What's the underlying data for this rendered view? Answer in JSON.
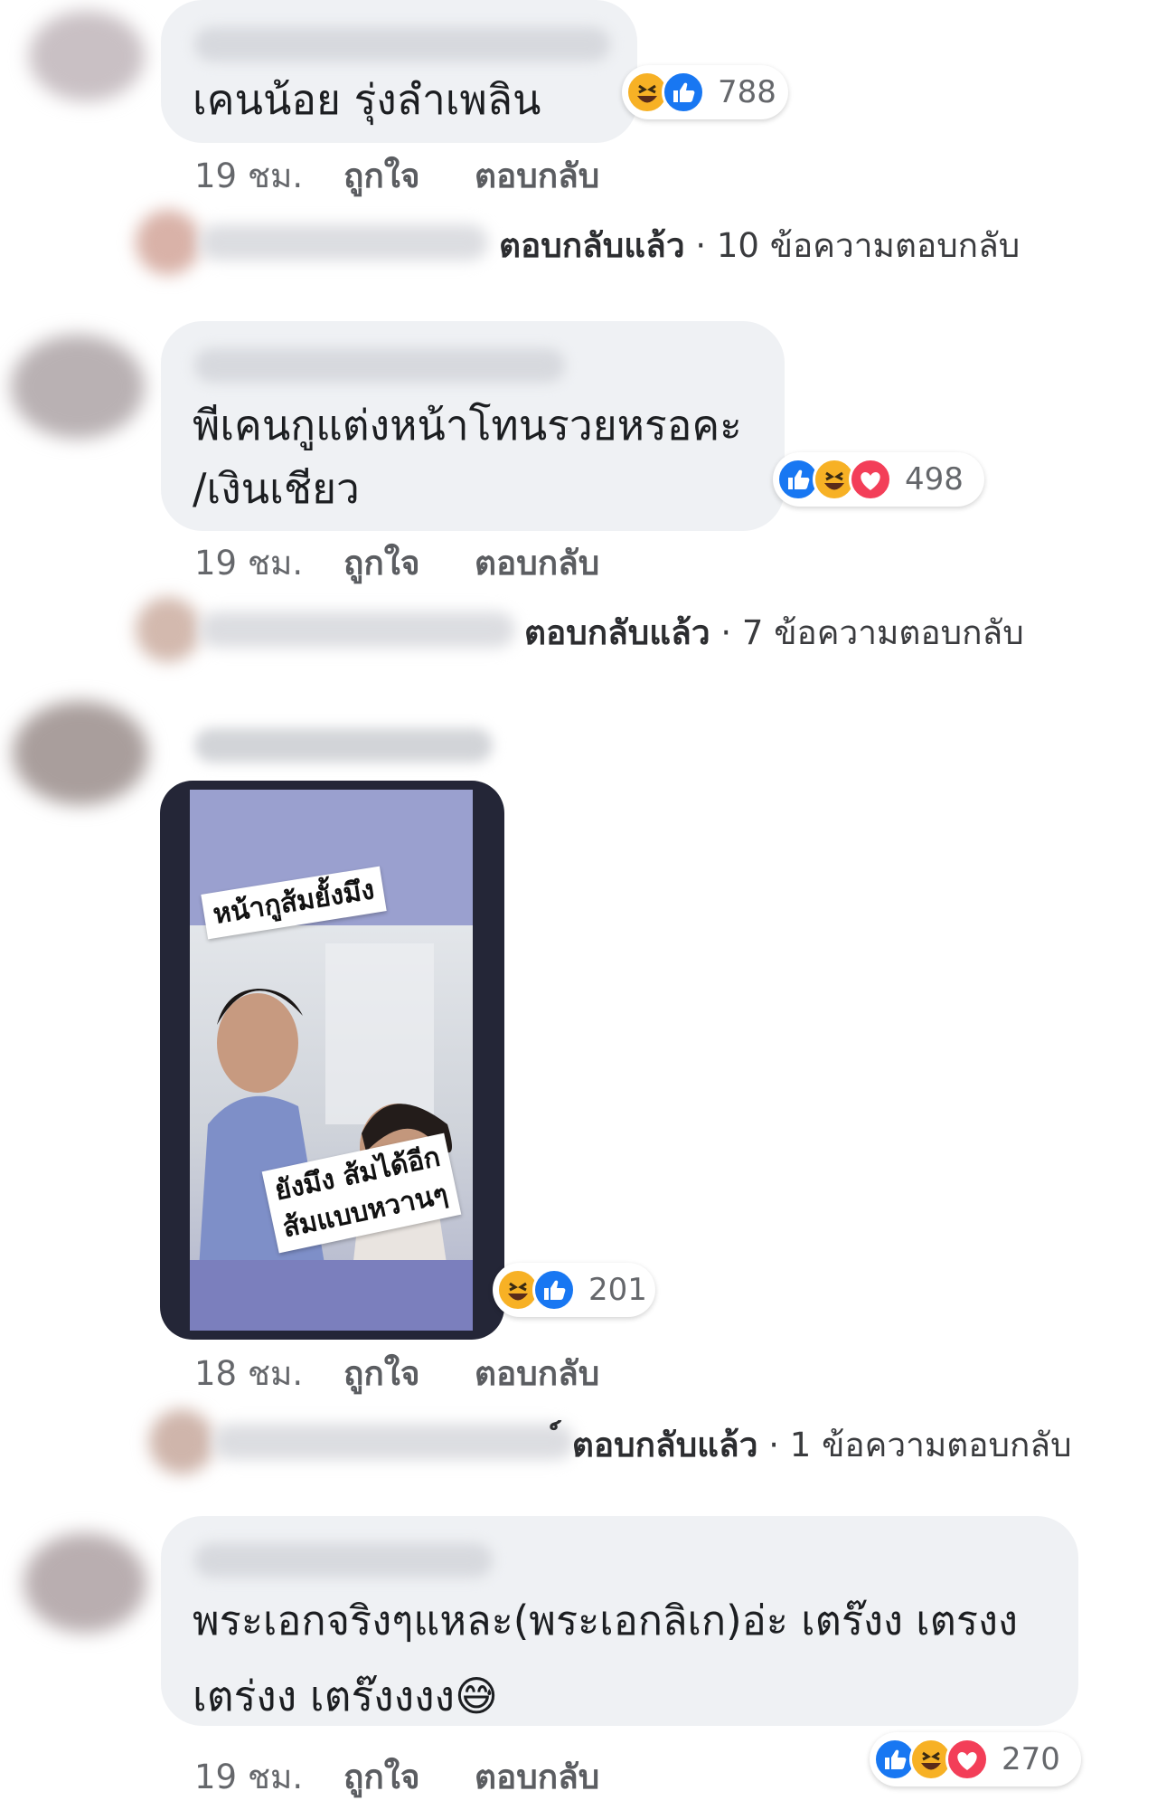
{
  "colors": {
    "bubble": "#eff1f4",
    "meta_text": "#65676b",
    "like": "#1877f2",
    "haha": "#f7b125",
    "love": "#f33e58"
  },
  "labels": {
    "like_action": "ถูกใจ",
    "reply_action": "ตอบกลับ"
  },
  "comments": [
    {
      "text_lines": [
        "เคนน้อย รุ่งลำเพลิน"
      ],
      "reactions": [
        "haha-icon",
        "like-icon"
      ],
      "reaction_count": "788",
      "time": "19 ชม.",
      "reply_summary": {
        "prefix": "ตอบกลับแล้ว",
        "rest": " · 10 ข้อความตอบกลับ"
      }
    },
    {
      "text_lines": [
        "พีเคนกูแต่งหน้าโทนรวยหรอคะ",
        "/เงินเชียว"
      ],
      "reactions": [
        "like-icon",
        "haha-icon",
        "love-icon"
      ],
      "reaction_count": "498",
      "time": "19 ชม.",
      "reply_summary": {
        "prefix": "ตอบกลับแล้ว",
        "rest": " · 7 ข้อความตอบกลับ"
      }
    },
    {
      "image": {
        "caption_top": "หน้ากูส้มยั้งมึง",
        "caption_bottom_1": "ยังมึง ส้มได้อีก",
        "caption_bottom_2": "ส้มแบบหวานๆ"
      },
      "reactions": [
        "haha-icon",
        "like-icon"
      ],
      "reaction_count": "201",
      "time": "18 ชม.",
      "reply_summary": {
        "prefix": "์ ตอบกลับแล้ว",
        "rest": " · 1 ข้อความตอบกลับ"
      }
    },
    {
      "text_lines": [
        "พระเอกจริงๆแหละ(พระเอกลิเก)อ่ะ เตร๊งง เตรงง",
        "เตร่งง เตร๊งงงง"
      ],
      "emoji": "😅",
      "reactions": [
        "like-icon",
        "haha-icon",
        "love-icon"
      ],
      "reaction_count": "270",
      "time": "19 ชม."
    }
  ]
}
